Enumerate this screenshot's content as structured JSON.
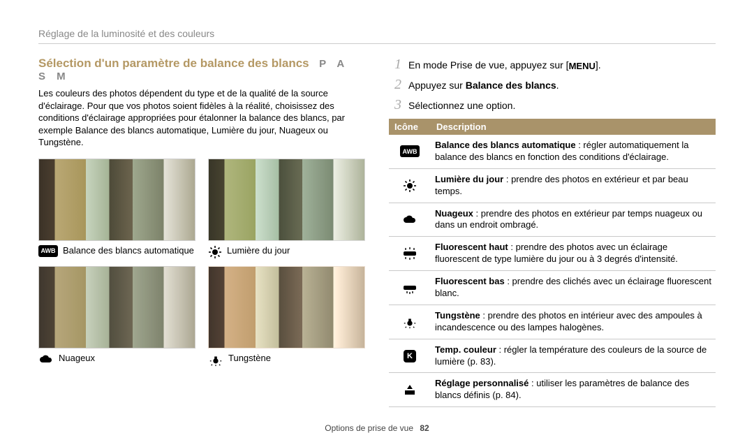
{
  "header": "Réglage de la luminosité et des couleurs",
  "section_title": "Sélection d'un paramètre de balance des blancs",
  "modes": "P A S M",
  "intro": "Les couleurs des photos dépendent du type et de la qualité de la source d'éclairage. Pour que vos photos soient fidèles à la réalité, choisissez des conditions d'éclairage appropriées pour étalonner la balance des blancs, par exemple Balance des blancs automatique, Lumière du jour, Nuageux ou Tungstène.",
  "examples": [
    {
      "icon": "awb-icon",
      "label": "Balance des blancs automatique"
    },
    {
      "icon": "sun-icon",
      "label": "Lumière du jour"
    },
    {
      "icon": "cloud-icon",
      "label": "Nuageux"
    },
    {
      "icon": "tung-icon",
      "label": "Tungstène"
    }
  ],
  "steps": [
    {
      "num": "1",
      "pre": "En mode Prise de vue, appuyez sur [",
      "btn": "MENU",
      "post": "]."
    },
    {
      "num": "2",
      "pre": "Appuyez sur ",
      "bold": "Balance des blancs",
      "post": "."
    },
    {
      "num": "3",
      "pre": "Sélectionnez une option.",
      "bold": "",
      "post": ""
    }
  ],
  "table": {
    "head_icon": "Icône",
    "head_desc": "Description",
    "rows": [
      {
        "icon": "awb-icon",
        "title": "Balance des blancs automatique",
        "text": " : régler automatiquement la balance des blancs en fonction des conditions d'éclairage."
      },
      {
        "icon": "sun-icon",
        "title": "Lumière du jour",
        "text": " : prendre des photos en extérieur et par beau temps."
      },
      {
        "icon": "cloud-icon",
        "title": "Nuageux",
        "text": " : prendre des photos en extérieur par temps nuageux ou dans un endroit ombragé."
      },
      {
        "icon": "fluohi-icon",
        "title": "Fluorescent haut",
        "text": " : prendre des photos avec un éclairage fluorescent de type lumière du jour ou à 3 degrés d'intensité."
      },
      {
        "icon": "fluolo-icon",
        "title": "Fluorescent bas",
        "text": " : prendre des clichés avec un éclairage fluorescent blanc."
      },
      {
        "icon": "tung-icon",
        "title": "Tungstène",
        "text": " : prendre des photos en intérieur avec des ampoules à incandescence ou des lampes halogènes."
      },
      {
        "icon": "k-icon",
        "title": "Temp. couleur",
        "text": " : régler la température des couleurs de la source de lumière (p. 83)."
      },
      {
        "icon": "custom-icon",
        "title": "Réglage personnalisé",
        "text": " : utiliser les paramètres de balance des blancs définis (p. 84)."
      }
    ]
  },
  "footer": {
    "section": "Options de prise de vue",
    "page": "82"
  }
}
